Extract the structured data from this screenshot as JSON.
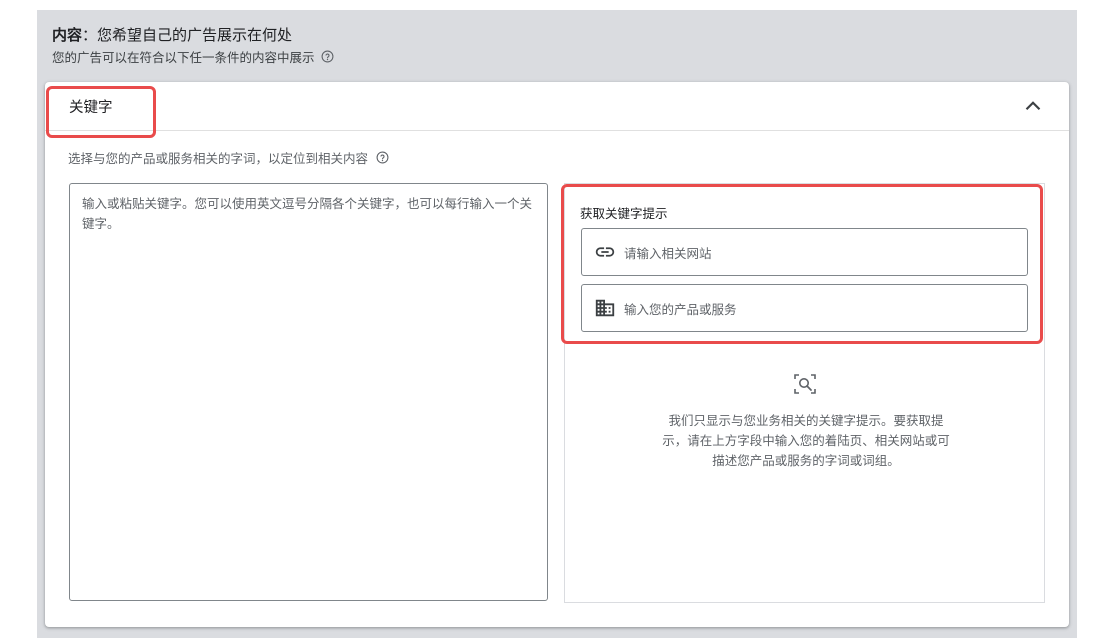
{
  "header": {
    "title_bold": "内容",
    "title_rest": "：您希望自己的广告展示在何处",
    "subtitle": "您的广告可以在符合以下任一条件的内容中展示"
  },
  "section": {
    "title": "关键字",
    "description": "选择与您的产品或服务相关的字词，以定位到相关内容"
  },
  "keyword_input": {
    "placeholder": "输入或粘贴关键字。您可以使用英文逗号分隔各个关键字，也可以每行输入一个关键字。"
  },
  "suggestions": {
    "title": "获取关键字提示",
    "website_placeholder": "请输入相关网站",
    "product_placeholder": "输入您的产品或服务",
    "info_text": "我们只显示与您业务相关的关键字提示。要获取提示，请在上方字段中输入您的着陆页、相关网站或可描述您产品或服务的字词或词组。"
  },
  "icons": {
    "help": "help-circle-icon",
    "collapse": "chevron-up-icon",
    "link": "link-icon",
    "business": "building-icon",
    "search": "search-image-icon"
  },
  "colors": {
    "highlight": "#e94b4b",
    "background_gray": "#dadce0"
  }
}
